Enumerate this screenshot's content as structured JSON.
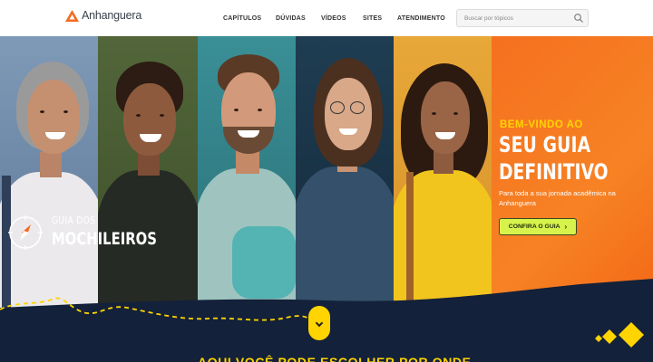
{
  "header": {
    "logo_text": "Anhanguera",
    "nav": [
      "CAPÍTULOS",
      "DÚVIDAS",
      "VÍDEOS",
      "SITES",
      "ATENDIMENTO"
    ],
    "search_placeholder": "Buscar por tópicos"
  },
  "hero": {
    "welcome": "BEM-VINDO AO",
    "title_line1": "SEU GUIA",
    "title_line2": "DEFINITIVO",
    "subtitle": "Para toda a sua jornada acadêmica na Anhanguera",
    "cta_label": "CONFIRA O GUIA",
    "cta_icon": "chevron-right-icon",
    "guide_line1": "GUIA DOS",
    "guide_line2": "MOCHILEIROS",
    "guide_icon": "compass-icon",
    "photos": [
      "woman-gray-hair",
      "man-curly-hair",
      "man-beard",
      "woman-glasses",
      "woman-curly-hair"
    ]
  },
  "colors": {
    "brand_orange": "#f36b1f",
    "accent_yellow": "#ffd400",
    "cta_green": "#d7f24b",
    "navy": "#13213a"
  },
  "next_section": {
    "heading_partial": "AQUI VOCÊ PODE ESCOLHER POR ONDE"
  }
}
